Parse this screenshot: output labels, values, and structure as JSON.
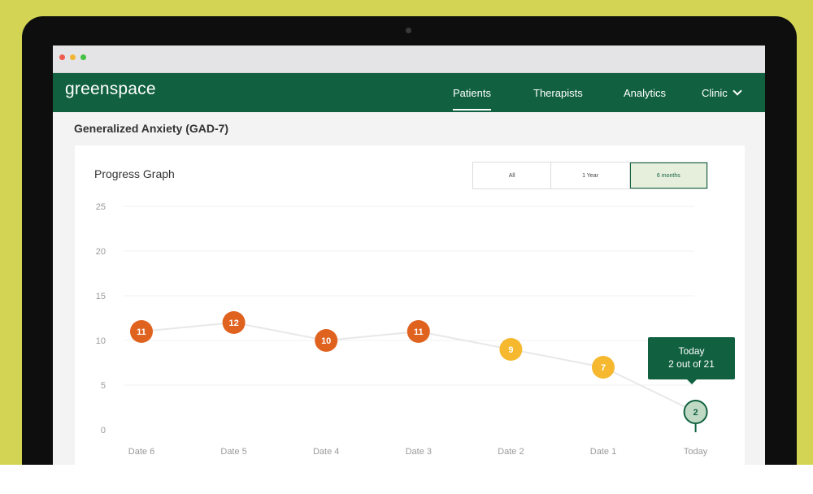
{
  "brand": {
    "name": "greenspace"
  },
  "nav": [
    {
      "label": "Patients",
      "active": true
    },
    {
      "label": "Therapists",
      "active": false
    },
    {
      "label": "Analytics",
      "active": false
    },
    {
      "label": "Clinic",
      "active": false,
      "has_dropdown": true
    }
  ],
  "page": {
    "title": "Generalized Anxiety (GAD-7)"
  },
  "card": {
    "title": "Progress Graph"
  },
  "range_filter": {
    "options": [
      "All",
      "1 Year",
      "6 months"
    ],
    "selected": "6 months"
  },
  "tooltip": {
    "line1": "Today",
    "line2": "2 out of 21"
  },
  "colors": {
    "brand_green": "#116140",
    "high_score": "#e0621f",
    "mid_score": "#f5b82e",
    "low_score": "#bfd9c5",
    "backdrop": "#d3d453"
  },
  "chart_data": {
    "type": "line",
    "title": "Progress Graph",
    "x": [
      "Date 6",
      "Date 5",
      "Date 4",
      "Date 3",
      "Date 2",
      "Date 1",
      "Today"
    ],
    "y": [
      11,
      12,
      10,
      11,
      9,
      7,
      2
    ],
    "ylim": [
      0,
      25
    ],
    "yticks": [
      0,
      5,
      10,
      15,
      20,
      25
    ],
    "grid": true,
    "point_labels": [
      "11",
      "12",
      "10",
      "11",
      "9",
      "7",
      "2"
    ]
  }
}
